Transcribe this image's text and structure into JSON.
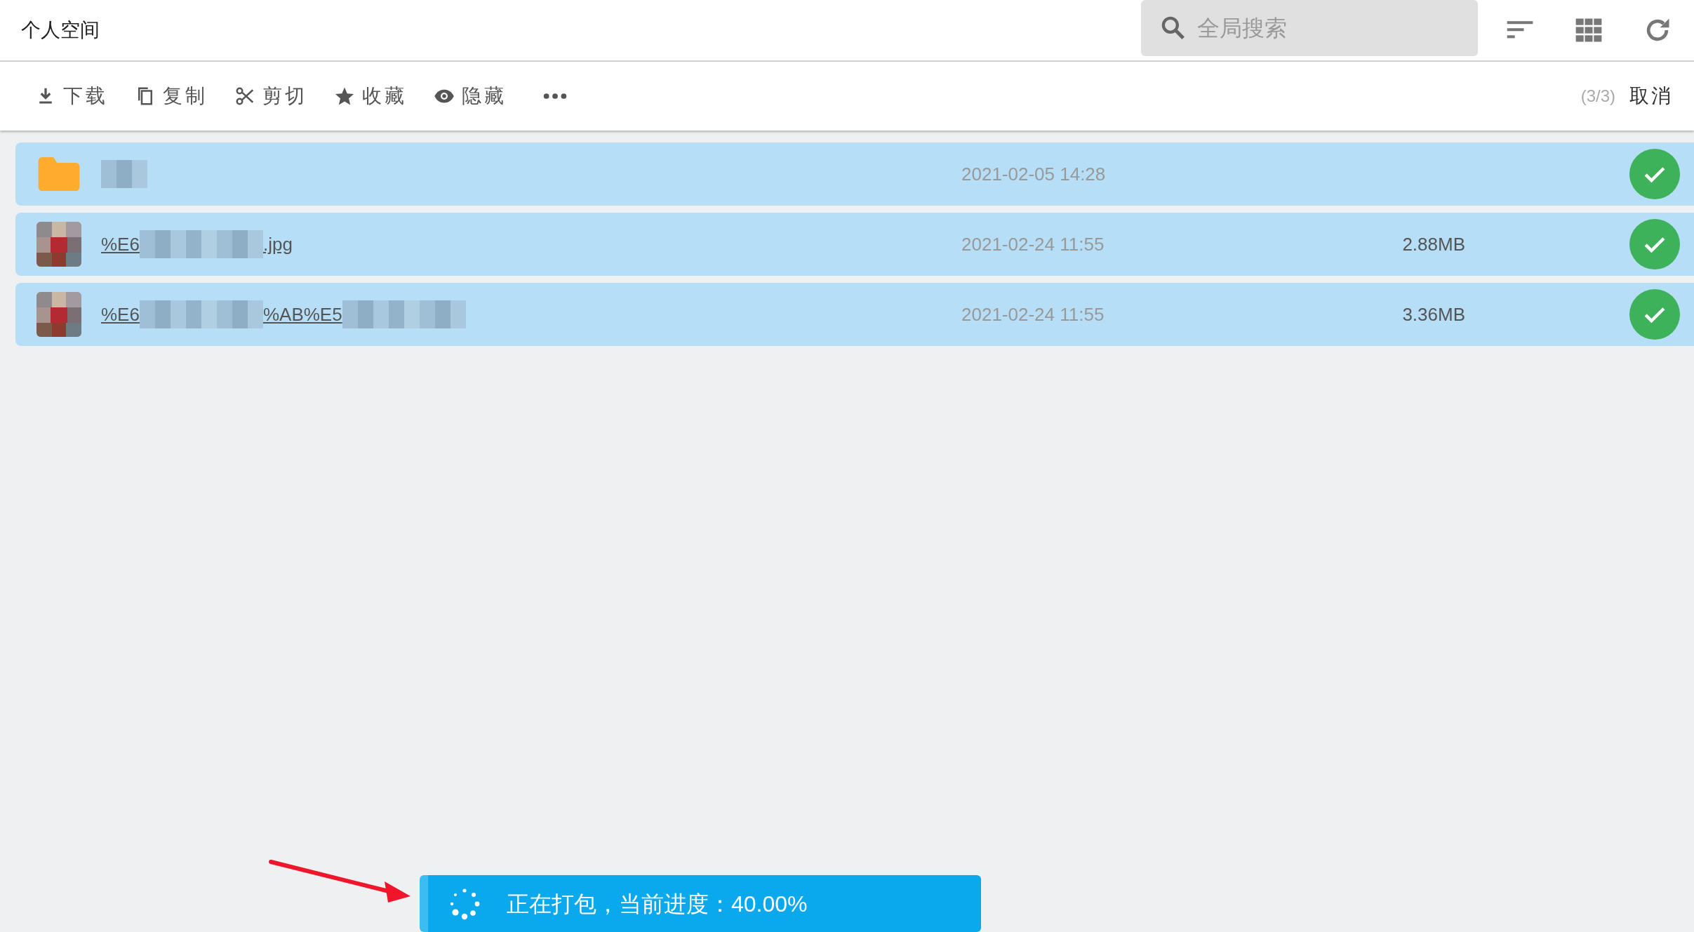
{
  "header": {
    "title": "个人空间",
    "search": {
      "placeholder": "全局搜索"
    }
  },
  "toolbar": {
    "actions": [
      {
        "kind": "download",
        "label": "下载"
      },
      {
        "kind": "copy",
        "label": "复制"
      },
      {
        "kind": "cut",
        "label": "剪切"
      },
      {
        "kind": "favorite",
        "label": "收藏"
      },
      {
        "kind": "hide",
        "label": "隐藏"
      },
      {
        "kind": "more"
      }
    ],
    "count": "(3/3)",
    "cancel": "取消"
  },
  "files": [
    {
      "kind": "folder",
      "segments": [
        {
          "kind": "redacted"
        }
      ],
      "date": "2021-02-05 14:28",
      "selected": true
    },
    {
      "segments": [
        {
          "kind": "text",
          "text": "%E6"
        },
        {
          "kind": "redacted"
        },
        {
          "kind": "text",
          "text": ".jpg"
        }
      ],
      "date": "2021-02-24 11:55",
      "size": "2.88MB",
      "selected": true
    },
    {
      "segments": [
        {
          "kind": "text",
          "text": "%E6"
        },
        {
          "kind": "redacted"
        },
        {
          "kind": "text",
          "text": "%AB%E5"
        },
        {
          "kind": "redacted"
        }
      ],
      "date": "2021-02-24 11:55",
      "size": "3.36MB",
      "selected": true
    }
  ],
  "toast": {
    "text": "正在打包，当前进度：40.00%"
  }
}
